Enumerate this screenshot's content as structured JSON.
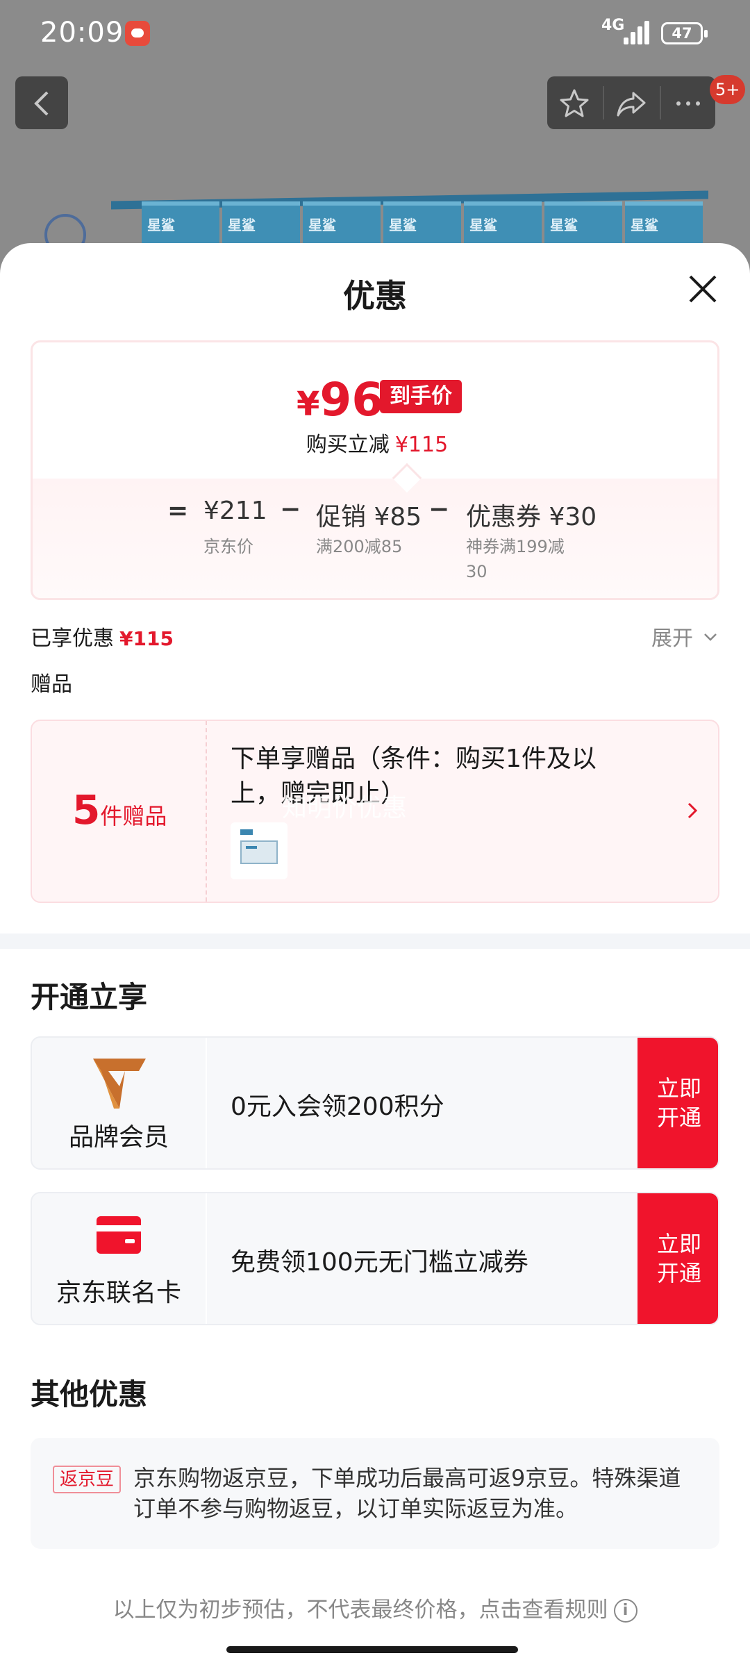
{
  "status_bar": {
    "time": "20:09",
    "network": "4G",
    "battery": "47"
  },
  "background_page": {
    "notification_count": "5+",
    "product_labels": [
      "星鲨",
      "星鲨",
      "星鲨",
      "星鲨",
      "星鲨",
      "星鲨",
      "星鲨"
    ]
  },
  "sheet": {
    "title": "优惠",
    "final_price": {
      "currency": "¥",
      "amount": "96",
      "tag": "到手价"
    },
    "saving": {
      "label": "购买立减",
      "amount": "¥115"
    },
    "breakdown": {
      "equals": "=",
      "minus": "−",
      "jd_price": {
        "value": "¥211",
        "caption": "京东价"
      },
      "promotion": {
        "value": "促销 ¥85",
        "caption": "满200减85"
      },
      "coupon": {
        "value": "优惠券 ¥30",
        "caption_line1": "神券满199减",
        "caption_line2": "30"
      }
    },
    "enjoyed": {
      "label": "已享优惠",
      "amount": "¥115"
    },
    "expand_label": "展开",
    "gift_heading": "赠品",
    "gift": {
      "count": "5",
      "unit": "件赠品",
      "description": "下单享赠品（条件：购买1件及以上，赠完即止）",
      "watermark": "知明价优惠"
    },
    "open_section_title": "开通立享",
    "memberships": [
      {
        "label": "品牌会员",
        "description": "0元入会领200积分",
        "cta_line1": "立即",
        "cta_line2": "开通"
      },
      {
        "label": "京东联名卡",
        "description": "免费领100元无门槛立减券",
        "cta_line1": "立即",
        "cta_line2": "开通"
      }
    ],
    "other_section_title": "其他优惠",
    "other": {
      "tag": "返京豆",
      "text": "京东购物返京豆，下单成功后最高可返9京豆。特殊渠道订单不参与购物返豆，以订单实际返豆为准。"
    },
    "footer_note": "以上仅为初步预估，不代表最终价格，点击查看规则",
    "info_icon_glyph": "i"
  },
  "colors": {
    "accent_red": "#e3182c",
    "cta_red": "#f0142c",
    "overlay_gray": "#8b8b8b"
  }
}
